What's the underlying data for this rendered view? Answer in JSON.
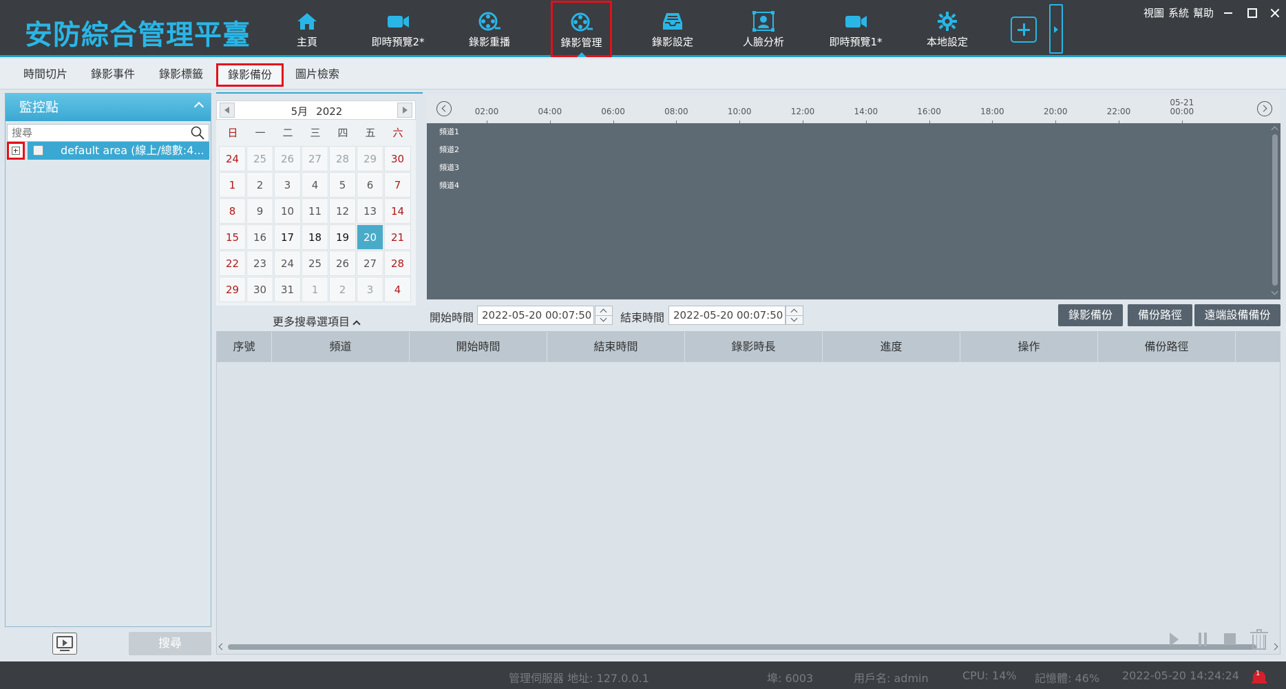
{
  "app": {
    "title": "安防綜合管理平臺"
  },
  "nav": {
    "items": [
      {
        "label": "主頁",
        "icon": "home-icon"
      },
      {
        "label": "即時預覽2*",
        "icon": "camera-icon"
      },
      {
        "label": "錄影重播",
        "icon": "film-reel-icon"
      },
      {
        "label": "錄影管理",
        "icon": "film-reel-icon"
      },
      {
        "label": "錄影設定",
        "icon": "inbox-icon"
      },
      {
        "label": "人臉分析",
        "icon": "face-frame-icon"
      },
      {
        "label": "即時預覽1*",
        "icon": "camera-icon"
      },
      {
        "label": "本地設定",
        "icon": "gear-icon"
      }
    ],
    "active_index": 3
  },
  "top_menu": {
    "view": "視圖",
    "system": "系統",
    "help": "幫助"
  },
  "subtabs": {
    "items": [
      "時間切片",
      "錄影事件",
      "錄影標籤",
      "錄影備份",
      "圖片檢索"
    ],
    "active_index": 3
  },
  "left_panel": {
    "title": "監控點",
    "search_placeholder": "搜尋",
    "tree_item": "default area (線上/總數:4...",
    "search_button": "搜尋"
  },
  "calendar": {
    "month": "5月",
    "year": "2022",
    "weekdays": [
      "日",
      "一",
      "二",
      "三",
      "四",
      "五",
      "六"
    ],
    "days": [
      [
        "24",
        "25",
        "26",
        "27",
        "28",
        "29",
        "30"
      ],
      [
        "1",
        "2",
        "3",
        "4",
        "5",
        "6",
        "7"
      ],
      [
        "8",
        "9",
        "10",
        "11",
        "12",
        "13",
        "14"
      ],
      [
        "15",
        "16",
        "17",
        "18",
        "19",
        "20",
        "21"
      ],
      [
        "22",
        "23",
        "24",
        "25",
        "26",
        "27",
        "28"
      ],
      [
        "29",
        "30",
        "31",
        "1",
        "2",
        "3",
        "4"
      ]
    ],
    "selected": "20",
    "more_options": "更多搜尋選項目"
  },
  "timeline": {
    "ticks": [
      "02:00",
      "04:00",
      "06:00",
      "08:00",
      "10:00",
      "12:00",
      "14:00",
      "16:00",
      "18:00",
      "20:00",
      "22:00"
    ],
    "end_tick_date": "05-21",
    "end_tick_time": "00:00",
    "channels": [
      "頻道1",
      "頻道2",
      "頻道3",
      "頻道4"
    ]
  },
  "time_range": {
    "start_label": "開始時間",
    "start_value": "2022-05-20 00:07:50",
    "end_label": "結束時間",
    "end_value": "2022-05-20 00:07:50"
  },
  "actions": {
    "backup": "錄影備份",
    "backup_path": "備份路徑",
    "remote_backup": "遠端設備備份"
  },
  "table": {
    "columns": [
      "序號",
      "頻道",
      "開始時間",
      "結束時間",
      "錄影時長",
      "進度",
      "操作",
      "備份路徑"
    ],
    "rows": []
  },
  "status": {
    "server": "管理伺服器 地址: 127.0.0.1",
    "port": "埠: 6003",
    "user": "用戶名: admin",
    "cpu": "CPU: 14%",
    "memory": "記憶體: 46%",
    "datetime": "2022-05-20 14:24:24",
    "alarm_count": "1"
  },
  "colors": {
    "accent": "#29b6e6",
    "header_bg": "#3a3d41",
    "highlight_border": "#e3101a",
    "selected_day": "#4aabc9"
  }
}
